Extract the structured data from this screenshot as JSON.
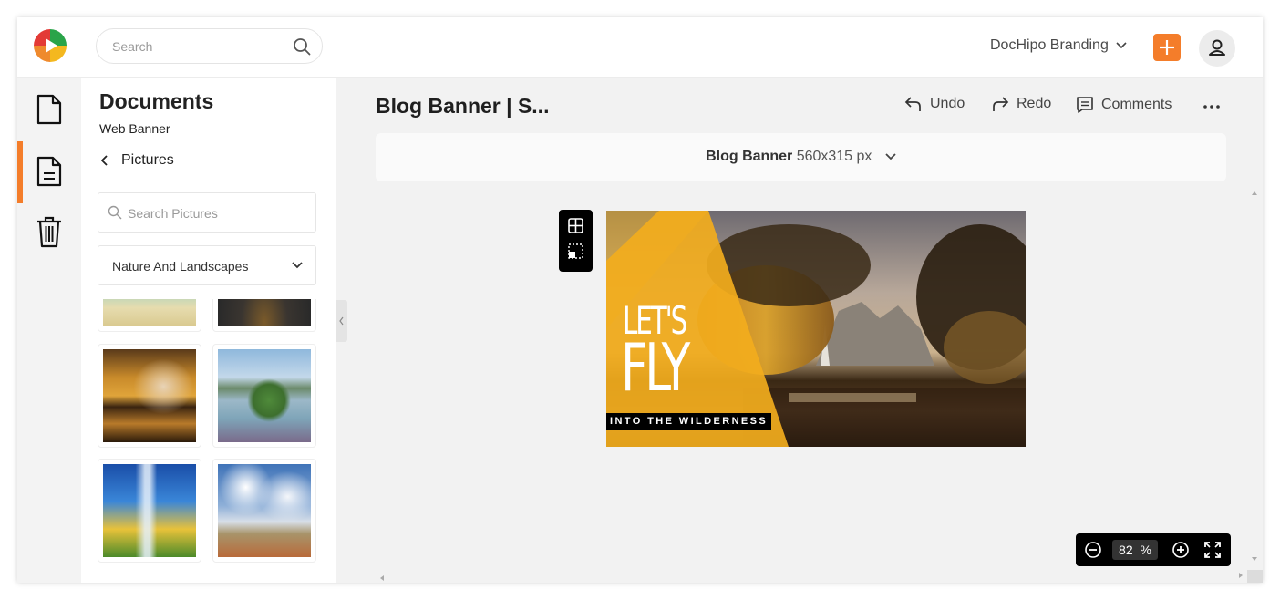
{
  "header": {
    "search_placeholder": "Search",
    "brand_label": "DocHipo Branding",
    "accent_color": "#f47d2a"
  },
  "rail": {
    "items": [
      {
        "name": "documents",
        "icon": "document-icon"
      },
      {
        "name": "templates",
        "icon": "document-text-icon",
        "active": true
      },
      {
        "name": "trash",
        "icon": "trash-icon"
      }
    ]
  },
  "panel": {
    "title": "Documents",
    "subtitle": "Web Banner",
    "back_label": "Pictures",
    "search_placeholder": "Search Pictures",
    "category": "Nature And Landscapes"
  },
  "editor": {
    "doc_title": "Blog Banner | S...",
    "undo_label": "Undo",
    "redo_label": "Redo",
    "comments_label": "Comments",
    "size_name": "Blog Banner",
    "size_dims": "560x315 px"
  },
  "banner": {
    "line1": "LET'S",
    "line2": "FLY",
    "tagline": "INTO THE WILDERNESS"
  },
  "zoom": {
    "value": "82",
    "unit": "%"
  }
}
